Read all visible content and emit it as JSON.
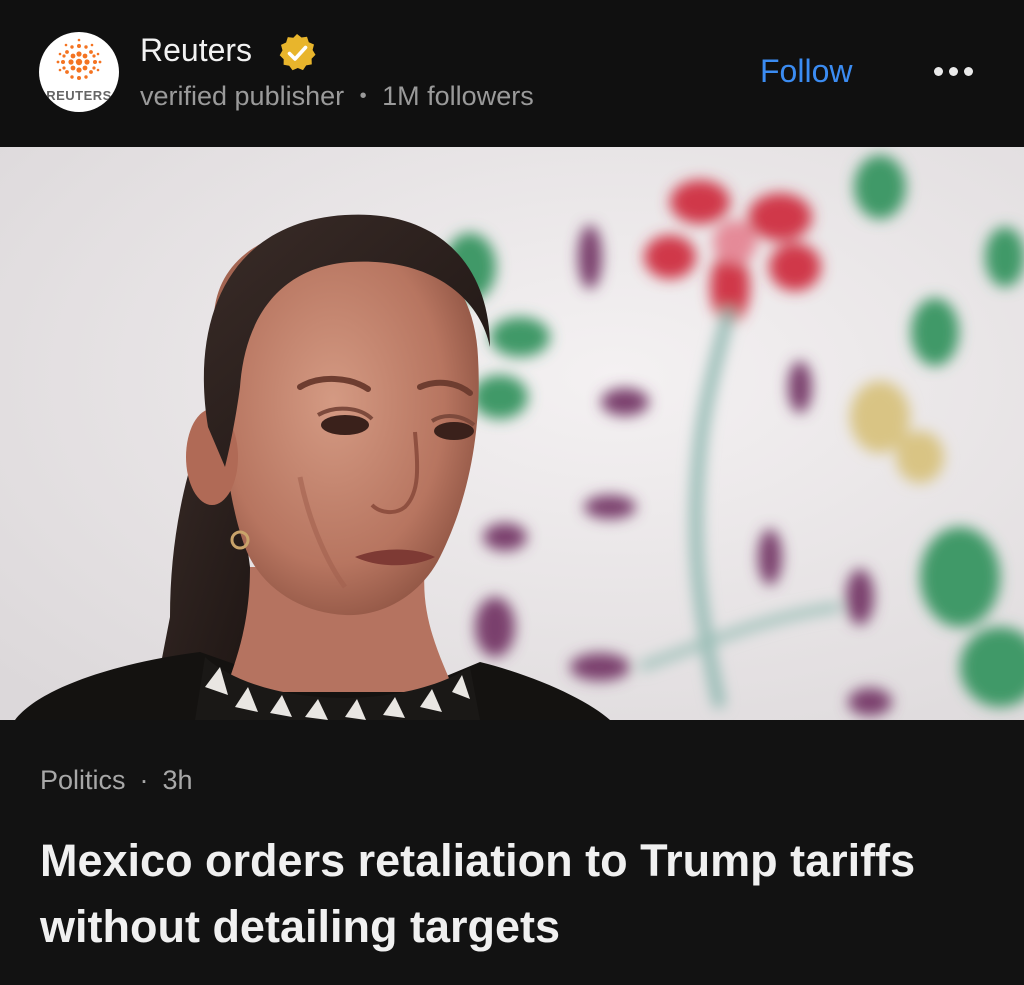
{
  "publisher": {
    "name": "Reuters",
    "logo_text": "REUTERS",
    "descriptor": "verified publisher",
    "separator": "•",
    "followers": "1M followers",
    "verified": true
  },
  "actions": {
    "follow_label": "Follow",
    "more_icon": "more-horizontal-icon"
  },
  "article": {
    "category": "Politics",
    "separator": "·",
    "age": "3h",
    "headline": "Mexico orders retaliation to Trump tariffs without detailing targets"
  },
  "colors": {
    "background": "#0d0d0d",
    "accent": "#3b8cf2",
    "badge": "#e8b52c",
    "logo_orange": "#f47321"
  }
}
